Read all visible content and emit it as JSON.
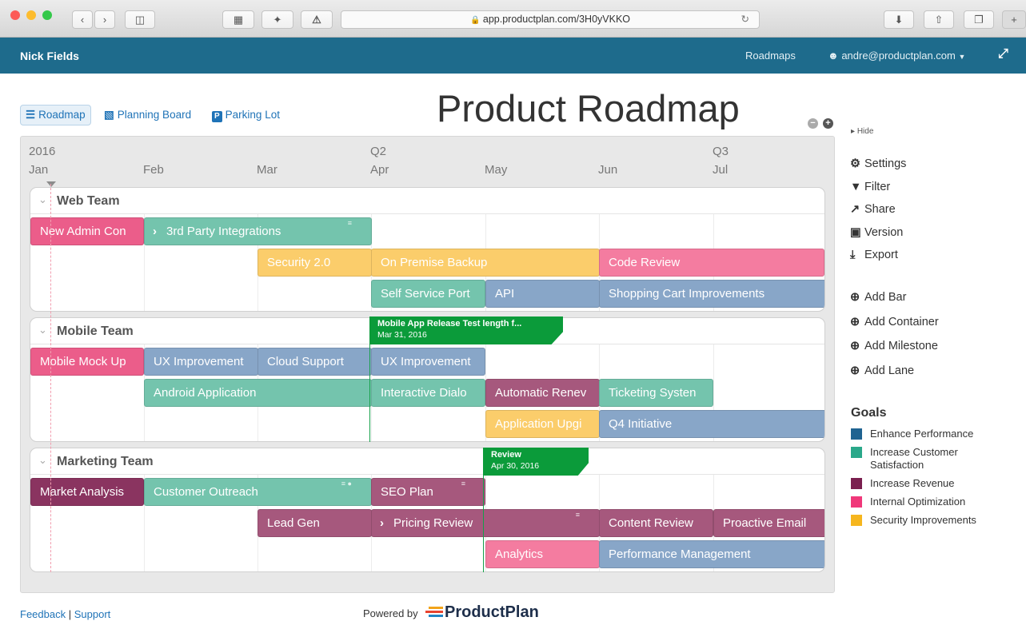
{
  "browser": {
    "url": "app.productplan.com/3H0yVKKO",
    "lock_icon": "lock-icon"
  },
  "header": {
    "user_name": "Nick Fields",
    "roadmaps_label": "Roadmaps",
    "account_label": "andre@productplan.com"
  },
  "views": {
    "roadmap": "Roadmap",
    "planning_board": "Planning Board",
    "parking_lot": "Parking Lot"
  },
  "page_title": "Product Roadmap",
  "timeline": {
    "years": [
      "2016",
      "Q2",
      "Q3"
    ],
    "months": [
      "Jan",
      "Feb",
      "Mar",
      "Apr",
      "May",
      "Jun",
      "Jul"
    ]
  },
  "lanes": [
    {
      "name": "Web Team",
      "bars": [
        {
          "label": "New Admin Con",
          "color": "#eb5d8a"
        },
        {
          "label": "3rd Party Integrations",
          "color": "#74c4ad"
        },
        {
          "label": "Security 2.0",
          "color": "#fbcd6b"
        },
        {
          "label": "On Premise Backup",
          "color": "#fbcd6b"
        },
        {
          "label": "Code Review",
          "color": "#f47ca0"
        },
        {
          "label": "Self Service Port",
          "color": "#74c4ad"
        },
        {
          "label": "API",
          "color": "#88a6c8"
        },
        {
          "label": "Shopping Cart Improvements",
          "color": "#88a6c8"
        }
      ]
    },
    {
      "name": "Mobile Team",
      "bars": [
        {
          "label": "Mobile Mock Up",
          "color": "#eb5d8a"
        },
        {
          "label": "UX Improvement",
          "color": "#88a6c8"
        },
        {
          "label": "Cloud Support",
          "color": "#88a6c8"
        },
        {
          "label": "UX Improvement",
          "color": "#88a6c8"
        },
        {
          "label": "Android Application",
          "color": "#74c4ad"
        },
        {
          "label": "Interactive Dialo",
          "color": "#74c4ad"
        },
        {
          "label": "Automatic Renev",
          "color": "#a6587d"
        },
        {
          "label": "Ticketing Systen",
          "color": "#74c4ad"
        },
        {
          "label": "Application Upgi",
          "color": "#fbcd6b"
        },
        {
          "label": "Q4 Initiative",
          "color": "#88a6c8"
        }
      ]
    },
    {
      "name": "Marketing Team",
      "bars": [
        {
          "label": "Market Analysis",
          "color": "#8a3460"
        },
        {
          "label": "Customer Outreach",
          "color": "#74c4ad"
        },
        {
          "label": "SEO Plan",
          "color": "#a6587d"
        },
        {
          "label": "Lead Gen",
          "color": "#a6587d"
        },
        {
          "label": "Pricing Review",
          "color": "#a6587d"
        },
        {
          "label": "Content Review",
          "color": "#a6587d"
        },
        {
          "label": "Proactive Email",
          "color": "#a6587d"
        },
        {
          "label": "Analytics",
          "color": "#f47ca0"
        },
        {
          "label": "Performance Management",
          "color": "#88a6c8"
        }
      ]
    }
  ],
  "milestones": [
    {
      "title": "Mobile App Release Test length f...",
      "date": "Mar 31, 2016"
    },
    {
      "title": "Review",
      "date": "Apr 30, 2016"
    }
  ],
  "sidebar": {
    "hide_label": "Hide",
    "actions": [
      "Settings",
      "Filter",
      "Share",
      "Version",
      "Export"
    ],
    "add_actions": [
      "Add Bar",
      "Add Container",
      "Add Milestone",
      "Add Lane"
    ]
  },
  "goals": {
    "heading": "Goals",
    "items": [
      {
        "label": "Enhance Performance",
        "color": "#1f6391"
      },
      {
        "label": "Increase Customer Satisfaction",
        "color": "#2aa88a"
      },
      {
        "label": "Increase Revenue",
        "color": "#7a1f4f"
      },
      {
        "label": "Internal Optimization",
        "color": "#f0387a"
      },
      {
        "label": "Security Improvements",
        "color": "#f6b61e"
      }
    ]
  },
  "footer": {
    "feedback": "Feedback",
    "separator": "|",
    "support": "Support",
    "powered_by": "Powered by",
    "brand": "ProductPlan"
  }
}
